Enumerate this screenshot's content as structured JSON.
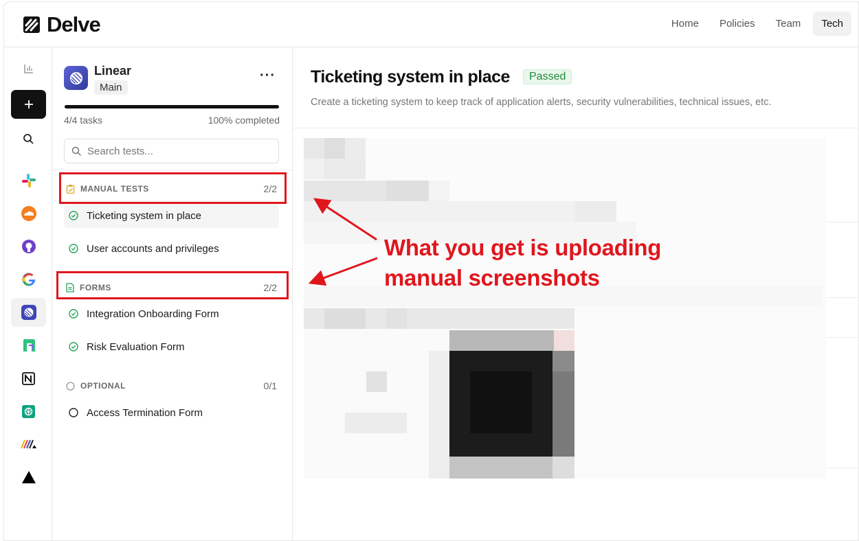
{
  "brand": {
    "name": "Delve"
  },
  "topnav": [
    {
      "label": "Home",
      "active": false
    },
    {
      "label": "Policies",
      "active": false
    },
    {
      "label": "Team",
      "active": false
    },
    {
      "label": "Tech",
      "active": true
    }
  ],
  "rail": [
    {
      "icon": "bar-chart-icon"
    },
    {
      "icon": "plus-icon"
    },
    {
      "icon": "search-icon"
    },
    {
      "icon": "slack-icon"
    },
    {
      "icon": "cloudflare-icon"
    },
    {
      "icon": "github-icon"
    },
    {
      "icon": "google-icon"
    },
    {
      "icon": "linear-icon"
    },
    {
      "icon": "n-logo-icon"
    },
    {
      "icon": "notion-icon"
    },
    {
      "icon": "openai-icon"
    },
    {
      "icon": "stripes-icon"
    },
    {
      "icon": "triangle-icon"
    }
  ],
  "project": {
    "name": "Linear",
    "branch": "Main",
    "tasks": "4/4 tasks",
    "percent": "100% completed",
    "progress": 1.0
  },
  "search": {
    "placeholder": "Search tests..."
  },
  "sections": [
    {
      "label": "MANUAL TESTS",
      "count": "2/2",
      "items": [
        "Ticketing system in place",
        "User accounts and privileges"
      ]
    },
    {
      "label": "FORMS",
      "count": "2/2",
      "items": [
        "Integration Onboarding Form",
        "Risk Evaluation Form"
      ]
    },
    {
      "label": "OPTIONAL",
      "count": "0/1",
      "items": [
        "Access Termination Form"
      ]
    }
  ],
  "detail": {
    "title": "Ticketing system in place",
    "status": "Passed",
    "description": "Create a ticketing system to keep track of application alerts, security vulnerabilities, technical issues, etc."
  },
  "annotation": {
    "line1": "What you get is uploading",
    "line2": "manual screenshots"
  },
  "colors": {
    "accent_red": "#e0161d",
    "passed_green": "#1f8a3a"
  }
}
